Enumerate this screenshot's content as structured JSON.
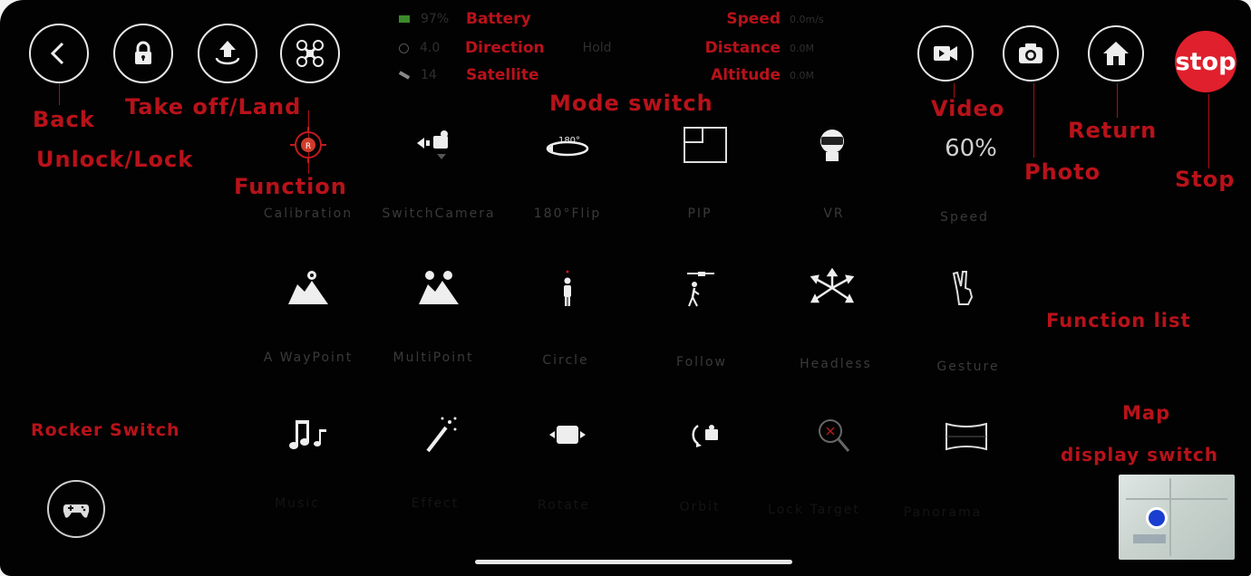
{
  "status": {
    "left": [
      {
        "value": "97%",
        "label": "Battery"
      },
      {
        "value": "4.0",
        "label": "Direction"
      },
      {
        "value": "14",
        "label": "Satellite"
      }
    ],
    "mode": "Hold",
    "right": [
      {
        "label": "Speed",
        "value": "0.0m/s"
      },
      {
        "label": "Distance",
        "value": "0.0M"
      },
      {
        "label": "Altitude",
        "value": "0.0M"
      }
    ]
  },
  "top_buttons": {
    "back": "back-arrow",
    "lock": "lock",
    "takeoff": "takeoff-arrow",
    "function": "drone",
    "video": "video-camera",
    "photo": "camera",
    "return": "home",
    "stop": "stop"
  },
  "annotations": {
    "back": "Back",
    "unlock_lock": "Unlock/Lock",
    "takeoff_land": "Take off/Land",
    "function": "Function",
    "mode_switch": "Mode switch",
    "video": "Video",
    "return": "Return",
    "photo": "Photo",
    "stop": "Stop",
    "function_list": "Function list",
    "rocker_switch": "Rocker Switch",
    "map_switch_line1": "Map",
    "map_switch_line2": "display switch"
  },
  "functions": [
    [
      {
        "label": "Calibration",
        "icon": "calibration"
      },
      {
        "label": "SwitchCamera",
        "icon": "switch-camera"
      },
      {
        "label": "180°Flip",
        "icon": "flip-180",
        "text": "180°"
      },
      {
        "label": "PIP",
        "icon": "pip"
      },
      {
        "label": "VR",
        "icon": "vr-headset"
      },
      {
        "label": "Speed",
        "icon": "speed",
        "text": "60%"
      }
    ],
    [
      {
        "label": "A WayPoint",
        "icon": "waypoint"
      },
      {
        "label": "MultiPoint",
        "icon": "multipoint"
      },
      {
        "label": "Circle",
        "icon": "circle-person"
      },
      {
        "label": "Follow",
        "icon": "follow-person"
      },
      {
        "label": "Headless",
        "icon": "headless-arrows"
      },
      {
        "label": "Gesture",
        "icon": "gesture-hand"
      }
    ],
    [
      {
        "label": "Music",
        "icon": "music-notes"
      },
      {
        "label": "Effect",
        "icon": "magic-wand"
      },
      {
        "label": "Rotate",
        "icon": "rotate"
      },
      {
        "label": "Orbit",
        "icon": "orbit-camera"
      },
      {
        "label": "Lock Target",
        "icon": "zoom-target"
      },
      {
        "label": "Panorama",
        "icon": "panorama"
      }
    ]
  ],
  "colors": {
    "background": "#020202",
    "annotation": "#b8121a",
    "stop_button": "#e0202c",
    "icon": "#f0f0f0"
  }
}
